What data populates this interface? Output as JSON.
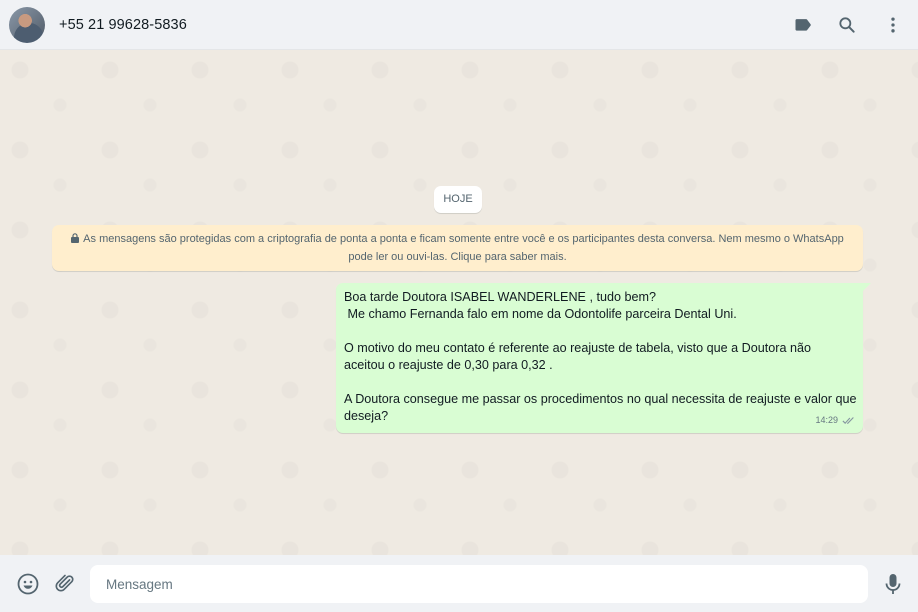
{
  "header": {
    "contact_name": "+55 21 99628-5836",
    "icons": [
      "label-icon",
      "search-icon",
      "menu-icon"
    ]
  },
  "chat": {
    "day_label": "HOJE",
    "encryption_notice": {
      "line1": "As mensagens são protegidas com a criptografia de ponta a ponta e ficam somente entre você e os participantes desta conversa. Nem mesmo o WhatsApp",
      "line2": "pode ler ou ouvi-las. Clique para saber mais."
    },
    "messages": [
      {
        "direction": "outgoing",
        "lines": [
          "Boa tarde Doutora ISABEL WANDERLENE , tudo bem?",
          " Me chamo Fernanda falo em nome da Odontolife parceira Dental Uni.",
          "",
          "O motivo do meu contato é referente ao reajuste de tabela, visto que a Doutora não",
          "aceitou o reajuste de 0,30 para 0,32 .",
          "",
          "A Doutora consegue me passar os procedimentos no qual necessita de reajuste e valor que",
          "deseja?"
        ],
        "time": "14:29",
        "status": "read"
      }
    ]
  },
  "footer": {
    "placeholder": "Mensagem",
    "value": ""
  },
  "colors": {
    "outgoing_bubble": "#d9fdd3",
    "notice_bg": "#ffeecd",
    "chat_bg": "#efeae2",
    "header_bg": "#f0f2f5"
  }
}
